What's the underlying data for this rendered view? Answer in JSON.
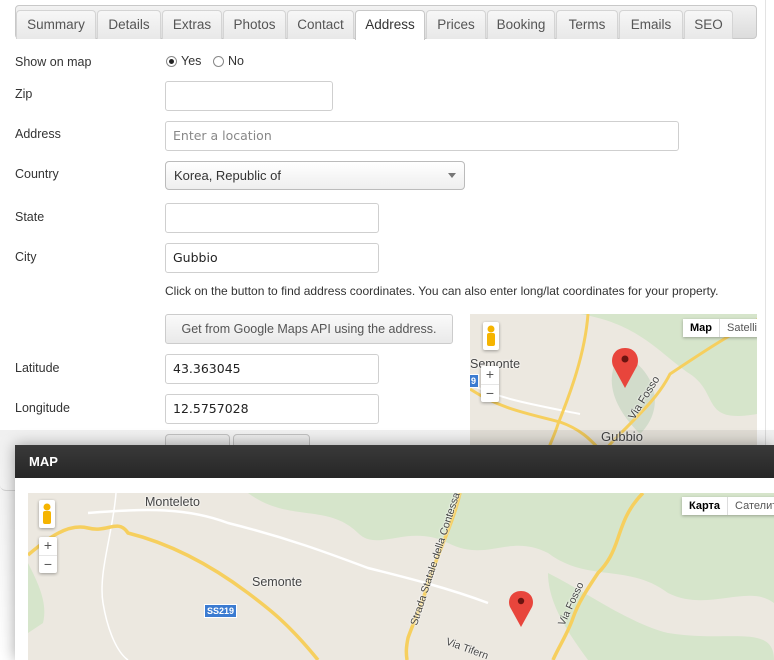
{
  "tabs": [
    {
      "label": "Summary",
      "active": false
    },
    {
      "label": "Details",
      "active": false
    },
    {
      "label": "Extras",
      "active": false
    },
    {
      "label": "Photos",
      "active": false
    },
    {
      "label": "Contact",
      "active": false
    },
    {
      "label": "Address",
      "active": true
    },
    {
      "label": "Prices",
      "active": false
    },
    {
      "label": "Booking",
      "active": false
    },
    {
      "label": "Terms",
      "active": false
    },
    {
      "label": "Emails",
      "active": false
    },
    {
      "label": "SEO",
      "active": false
    }
  ],
  "form": {
    "show_on_map": {
      "label": "Show on map",
      "options": [
        "Yes",
        "No"
      ],
      "selected": "Yes"
    },
    "zip": {
      "label": "Zip",
      "value": ""
    },
    "address": {
      "label": "Address",
      "value": "",
      "placeholder": "Enter a location"
    },
    "country": {
      "label": "Country",
      "value": "Korea, Republic of"
    },
    "state": {
      "label": "State",
      "value": ""
    },
    "city": {
      "label": "City",
      "value": "Gubbio"
    },
    "hint": "Click on the button to find address coordinates. You can also enter long/lat coordinates for your property.",
    "geocode_button": "Get from Google Maps API using the address.",
    "latitude": {
      "label": "Latitude",
      "value": "43.363045"
    },
    "longitude": {
      "label": "Longitude",
      "value": "12.5757028"
    }
  },
  "small_map": {
    "map_type": [
      "Map",
      "Satelli"
    ],
    "labels": {
      "semonte": "Semonte",
      "via_fosso": "Via Fosso",
      "gubbio": "Gubbio",
      "road_shield": "9"
    },
    "zoom_in": "+",
    "zoom_out": "−"
  },
  "modal": {
    "title": "MAP",
    "map_type": [
      "Карта",
      "Сателит"
    ],
    "labels": {
      "monteleto": "Monteleto",
      "semonte": "Semonte",
      "ss219": "SS219",
      "strada": "Strada Statale della Contessa",
      "via_fosso": "Via Fosso",
      "via_tifer": "Via Tifern"
    },
    "zoom_in": "+",
    "zoom_out": "−"
  },
  "colors": {
    "map_land": "#ece8e0",
    "map_forest": "#cfe1c3",
    "road_major": "#f6cf5e",
    "marker": "#e8453c",
    "modal_header": "#2e2e2e"
  }
}
